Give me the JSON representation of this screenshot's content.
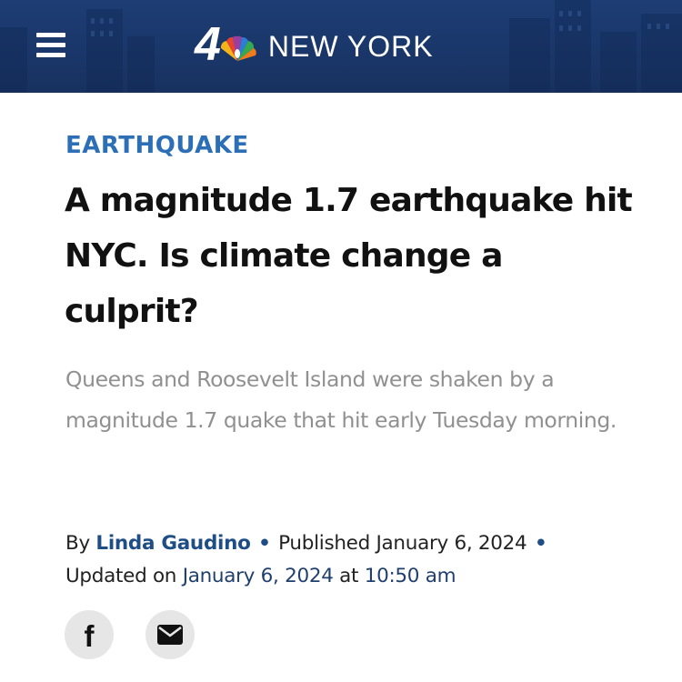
{
  "header": {
    "logo_number": "4",
    "logo_text": "NEW YORK",
    "menu_icon": "hamburger-menu-icon",
    "peacock_icon": "nbc-peacock-icon",
    "background_color": "#1b3a6f"
  },
  "article": {
    "category": "EARTHQUAKE",
    "headline": "A magnitude 1.7 earthquake hit NYC. Is climate change a culprit?",
    "dek": "Queens and Roosevelt Island were shaken by a magnitude 1.7 quake that hit early Tuesday morning.",
    "byline": {
      "by_label": "By",
      "author": "Linda Gaudino",
      "separator": "•",
      "published_label": "Published",
      "published_date": "January 6, 2024",
      "updated_label": "Updated on",
      "updated_date": "January 6, 2024",
      "at_label": "at",
      "updated_time": "10:50 am"
    },
    "category_color": "#2d6fb7"
  },
  "share": {
    "facebook_icon": "facebook-icon",
    "email_icon": "email-icon"
  }
}
